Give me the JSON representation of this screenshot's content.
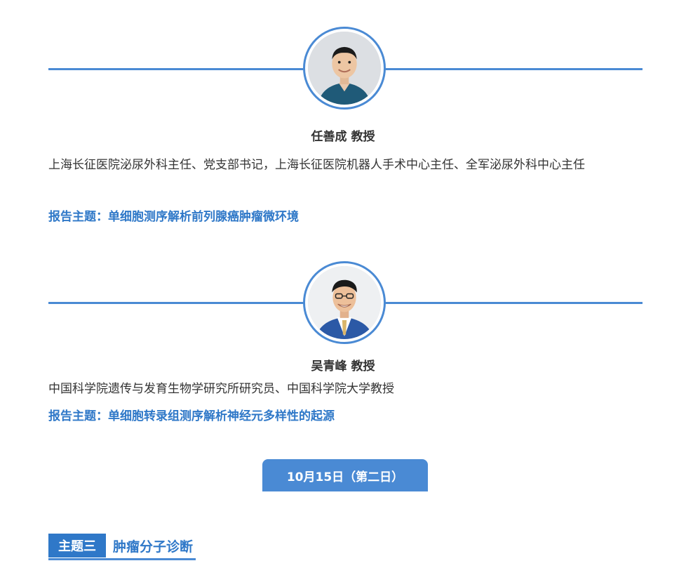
{
  "speakers": [
    {
      "name": "任善成 教授",
      "description": "上海长征医院泌尿外科主任、党支部书记，上海长征医院机器人手术中心主任、全军泌尿外科中心主任",
      "topic": "报告主题：单细胞测序解析前列腺癌肿瘤微环境",
      "photo": "portrait-photo"
    },
    {
      "name": "吴青峰 教授",
      "description": "中国科学院遗传与发育生物学研究所研究员、中国科学院大学教授",
      "topic": "报告主题：单细胞转录组测序解析神经元多样性的起源",
      "photo": "portrait-photo"
    }
  ],
  "day_tab": {
    "label": "10月15日（第二日）"
  },
  "theme": {
    "badge": "主题三",
    "title": "肿瘤分子诊断"
  },
  "colors": {
    "accent": "#4a8ad4",
    "topic_text": "#2f78c8",
    "body_text": "#333333"
  }
}
